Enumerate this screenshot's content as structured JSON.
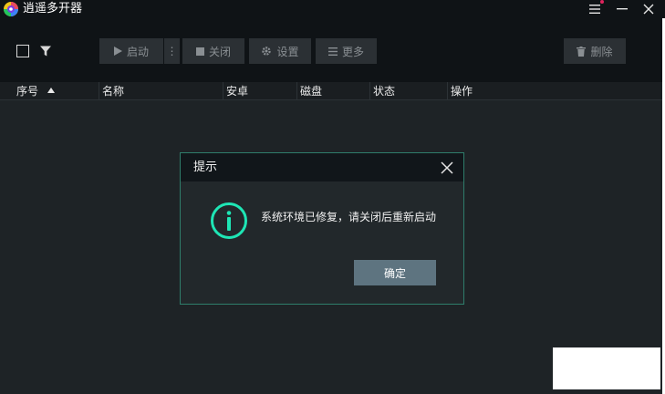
{
  "app": {
    "title": "逍遥多开器",
    "icon": "memu-logo-icon"
  },
  "window_controls": {
    "menu_icon": "menu-icon",
    "minimize_icon": "minimize-icon",
    "close_icon": "close-icon"
  },
  "toolbar": {
    "start_label": "启动",
    "close_label": "关闭",
    "settings_label": "设置",
    "more_label": "更多",
    "delete_label": "删除",
    "more_dots": "⋮"
  },
  "table": {
    "columns": [
      "序号",
      "名称",
      "安卓",
      "磁盘",
      "状态",
      "操作"
    ]
  },
  "dialog": {
    "title": "提示",
    "message": "系统环境已修复，请关闭后重新启动",
    "confirm_label": "确定"
  },
  "colors": {
    "accent": "#1ee6b5",
    "background": "#1e2326",
    "titlebar": "#0f1316",
    "notify": "#e0245e"
  }
}
